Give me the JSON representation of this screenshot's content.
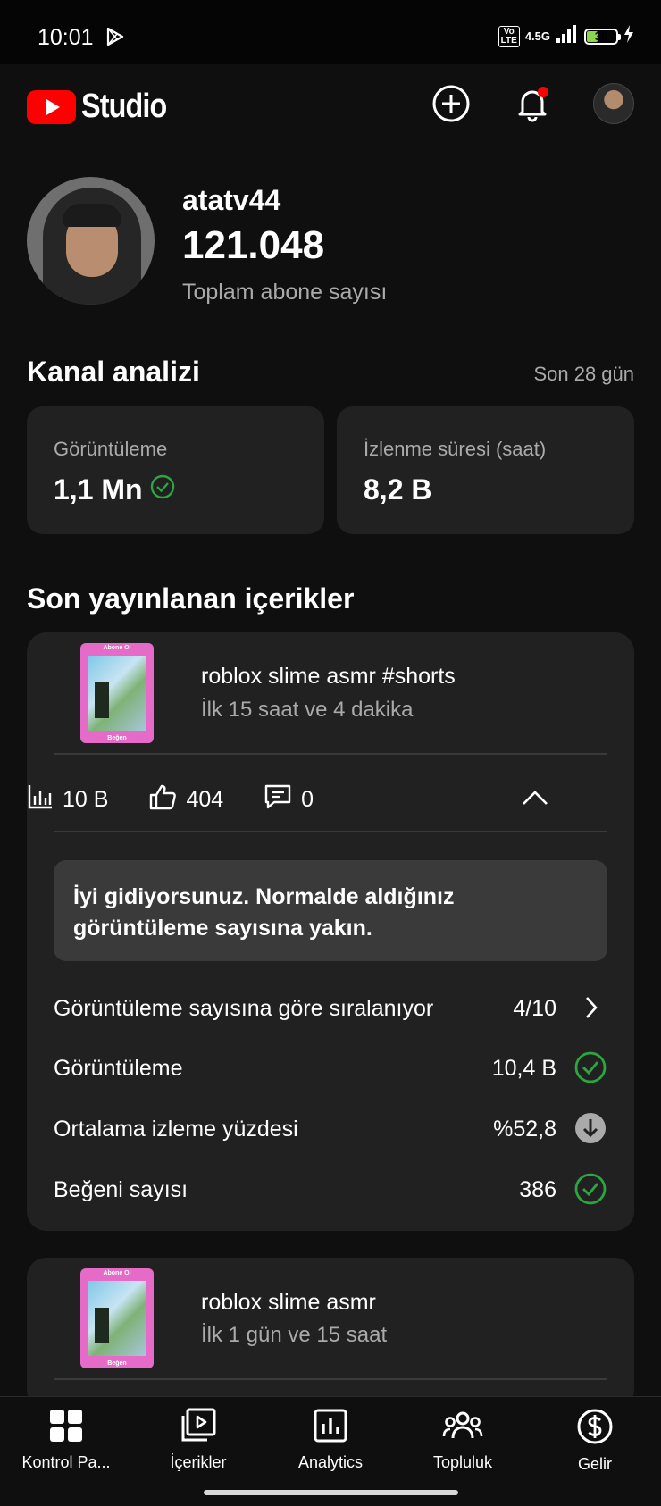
{
  "status_bar": {
    "time": "10:01",
    "network": "4.5G",
    "battery": "38"
  },
  "header": {
    "app_name": "Studio"
  },
  "profile": {
    "channel_name": "atatv44",
    "subscriber_count": "121.048",
    "subscriber_label": "Toplam abone sayısı"
  },
  "analytics": {
    "title": "Kanal analizi",
    "period": "Son 28 gün",
    "cards": [
      {
        "label": "Görüntüleme",
        "value": "1,1 Mn"
      },
      {
        "label": "İzlenme süresi (saat)",
        "value": "8,2 B"
      }
    ]
  },
  "recent": {
    "title": "Son yayınlanan içerikler",
    "items": [
      {
        "thumb_top": "Abone Ol",
        "thumb_bottom": "Beğen",
        "title": "roblox slime asmr #shorts",
        "subtitle": "İlk 15 saat ve 4 dakika",
        "views": "10 B",
        "likes": "404",
        "comments": "0",
        "insight": "İyi gidiyorsunuz. Normalde aldığınız görüntüleme sayısına yakın.",
        "rows": [
          {
            "label": "Görüntüleme sayısına göre sıralanıyor",
            "value": "4/10"
          },
          {
            "label": "Görüntüleme",
            "value": "10,4 B"
          },
          {
            "label": "Ortalama izleme yüzdesi",
            "value": "%52,8"
          },
          {
            "label": "Beğeni sayısı",
            "value": "386"
          }
        ]
      },
      {
        "thumb_top": "Abone Ol",
        "thumb_bottom": "Beğen",
        "title": "roblox slime asmr",
        "subtitle": "İlk 1 gün ve 15 saat"
      }
    ]
  },
  "nav": {
    "items": [
      {
        "label": "Kontrol Pa..."
      },
      {
        "label": "İçerikler"
      },
      {
        "label": "Analytics"
      },
      {
        "label": "Topluluk"
      },
      {
        "label": "Gelir"
      }
    ]
  },
  "colors": {
    "accent_red": "#ff0000",
    "success_green": "#2ba640",
    "card_bg": "#212121",
    "page_bg": "#0f0f0f"
  }
}
